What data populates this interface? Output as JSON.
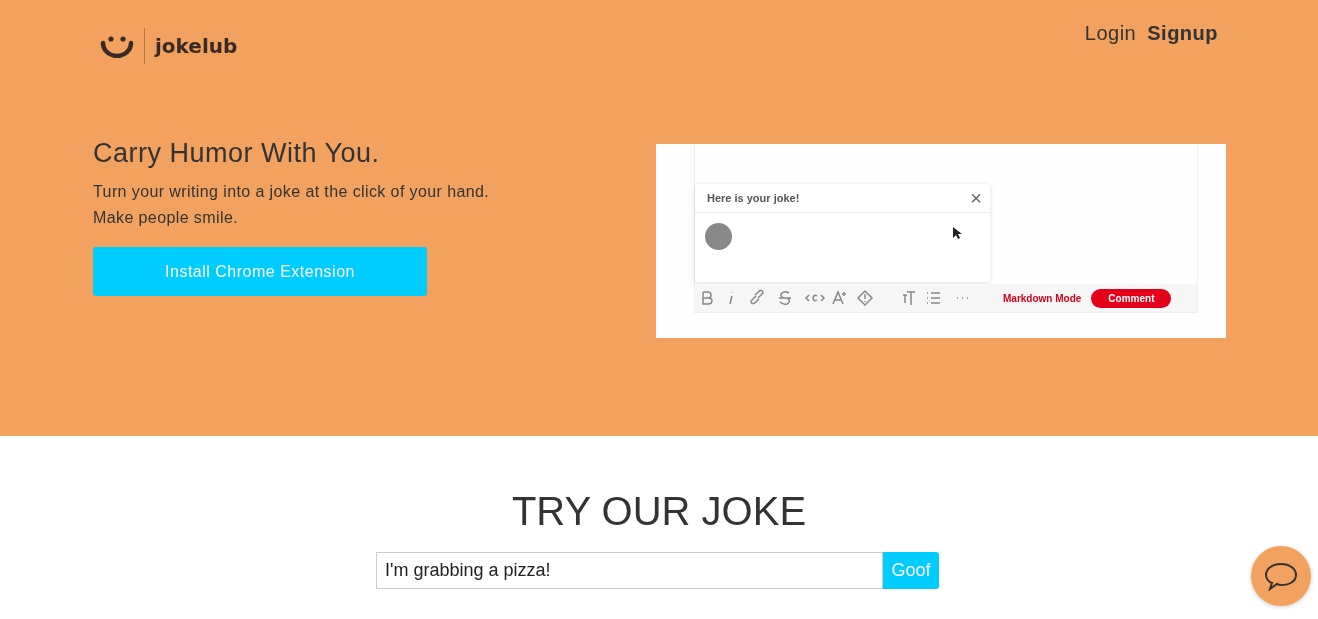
{
  "header": {
    "logo": "jokelub",
    "nav": [
      {
        "label": "Login",
        "kind": "plain"
      },
      {
        "label": "Signup",
        "kind": "bold"
      }
    ]
  },
  "hero": {
    "title": "Carry Humor With You.",
    "lines": [
      "Turn your writing into a joke at the click of your hand.",
      "Make people smile."
    ],
    "button": "Install Chrome Extension",
    "demo": {
      "popup_title": "Here is your joke!",
      "close": "×",
      "markdown": "Markdown Mode",
      "comment": "Comment"
    }
  },
  "try": {
    "title": "TRY OUR JOKE",
    "input": "I'm grabbing a pizza!",
    "button": "Goof"
  }
}
